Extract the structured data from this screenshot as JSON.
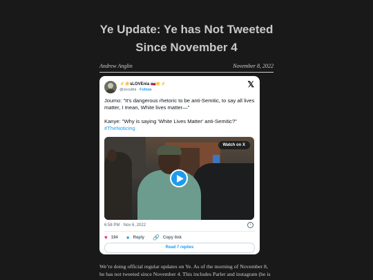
{
  "article": {
    "title_line1": "Ye Update: Ye has Not Tweeted",
    "title_line2": "Since November 4",
    "author": "Andrew Anglin",
    "date": "November 8, 2022",
    "body": "We’re doing official regular updates on Ye. As of the morning of November 8, he has not tweeted since November 4. This includes Parler and instagram (he is"
  },
  "tweet": {
    "display_name": "⚡☀️sLOVEnia 🇸🇮☀️⚡",
    "handle": "@occultni",
    "separator": " · ",
    "follow": "Follow",
    "logo_icon": "x-logo-icon",
    "text_line1": "Journo: \"It's dangerous rhetoric to be anti-Semitic, to say all lives matter, I mean, White lives matter—\"",
    "text_line2": "Kanye: \"Why is saying 'White Lives Matter' anti-Semitic?\"",
    "hashtag": "#TheNoticing",
    "watch_label": "Watch on X",
    "timestamp": "6:58 PM · Nov 6, 2022",
    "likes": "194",
    "reply_label": "Reply",
    "copy_label": "Copy link",
    "read_replies": "Read 7 replies",
    "colors": {
      "accent": "#1d9bf0",
      "like": "#f91880"
    }
  }
}
